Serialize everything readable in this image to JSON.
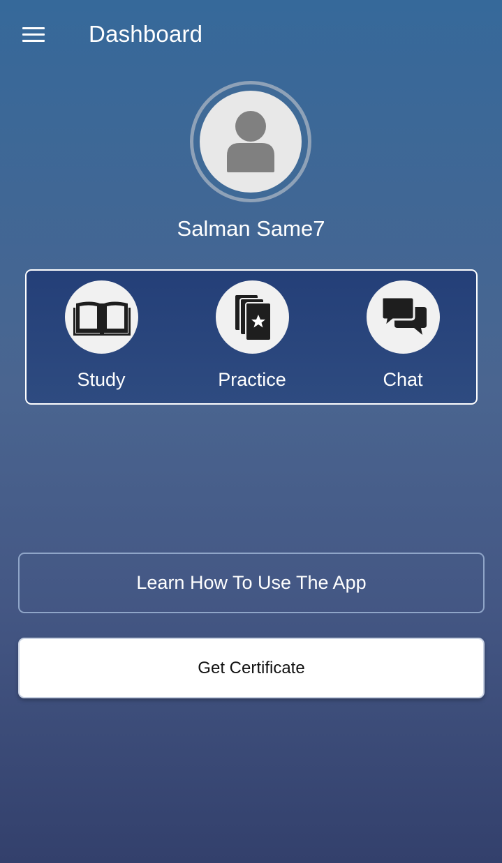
{
  "header": {
    "title": "Dashboard",
    "menu_icon": "hamburger-menu-icon"
  },
  "profile": {
    "avatar_icon": "user-placeholder-icon",
    "name": "Salman Same7"
  },
  "actions": [
    {
      "label": "Study",
      "icon": "open-book-icon"
    },
    {
      "label": "Practice",
      "icon": "card-stack-star-icon"
    },
    {
      "label": "Chat",
      "icon": "chat-bubbles-icon"
    }
  ],
  "buttons": {
    "learn_label": "Learn How To Use The App",
    "certificate_label": "Get Certificate"
  },
  "colors": {
    "gradient_top": "#36699a",
    "gradient_bottom": "#33406c",
    "panel": "#243f78",
    "icon_dark": "#1e1e1e"
  }
}
